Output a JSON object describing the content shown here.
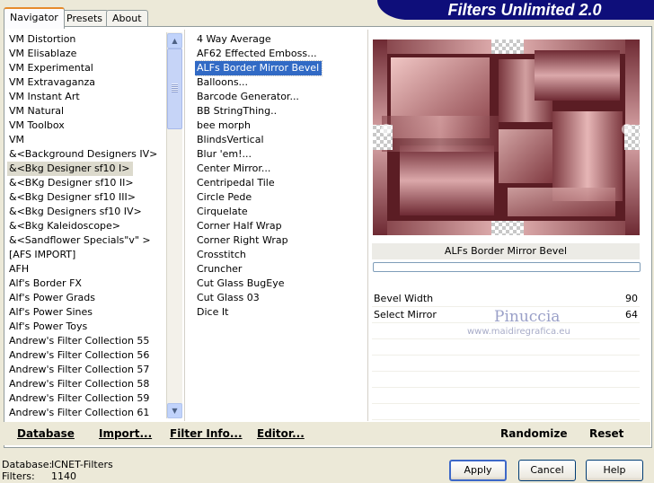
{
  "window": {
    "banner_title": "Filters Unlimited 2.0"
  },
  "tabs": [
    {
      "label": "Navigator"
    },
    {
      "label": "Presets"
    },
    {
      "label": "About"
    }
  ],
  "categories": [
    "VM Distortion",
    "VM Elisablaze",
    "VM Experimental",
    "VM Extravaganza",
    "VM Instant Art",
    "VM Natural",
    "VM Toolbox",
    "VM",
    "&<Background Designers IV>",
    "&<Bkg Designer sf10 I>",
    "&<BKg Designer sf10 II>",
    "&<Bkg Designer sf10 III>",
    "&<Bkg Designers sf10 IV>",
    "&<Bkg Kaleidoscope>",
    "&<Sandflower Specials\"v\" >",
    "[AFS IMPORT]",
    "AFH",
    "Alf's Border FX",
    "Alf's Power Grads",
    "Alf's Power Sines",
    "Alf's Power Toys",
    "Andrew's Filter Collection 55",
    "Andrew's Filter Collection 56",
    "Andrew's Filter Collection 57",
    "Andrew's Filter Collection 58",
    "Andrew's Filter Collection 59",
    "Andrew's Filter Collection 61"
  ],
  "categories_highlighted": "&<Bkg Designer sf10 I>",
  "filters": [
    "4 Way Average",
    "AF62 Effected Emboss...",
    "ALFs Border Mirror Bevel",
    "Balloons...",
    "Barcode Generator...",
    "BB StringThing..",
    "bee morph",
    "BlindsVertical",
    "Blur 'em!...",
    "Center Mirror...",
    "Centripedal Tile",
    "Circle Pede",
    "Cirquelate",
    "Corner Half Wrap",
    "Corner Right Wrap",
    "Crosstitch",
    "Cruncher",
    "Cut Glass  BugEye",
    "Cut Glass 03",
    "Dice It"
  ],
  "filters_selected": "ALFs Border Mirror Bevel",
  "preview": {
    "filter_name": "ALFs Border Mirror Bevel",
    "progress": 0
  },
  "params": [
    {
      "label": "Bevel Width",
      "value": "90"
    },
    {
      "label": "Select Mirror",
      "value": "64"
    }
  ],
  "watermark": {
    "name": "Pinuccia",
    "url": "www.maidiregrafica.eu"
  },
  "bottom_bar": {
    "database": "Database",
    "import": "Import...",
    "filter_info": "Filter Info...",
    "editor": "Editor...",
    "randomize": "Randomize",
    "reset": "Reset"
  },
  "status": {
    "database_label": "Database:",
    "database_value": "ICNET-Filters",
    "filters_label": "Filters:",
    "filters_value": "1140"
  },
  "buttons": {
    "apply": "Apply",
    "cancel": "Cancel",
    "help": "Help"
  },
  "colors": {
    "banner": "#0e0e7a",
    "selection": "#316ac5",
    "preview_base": "#c48a8e"
  }
}
